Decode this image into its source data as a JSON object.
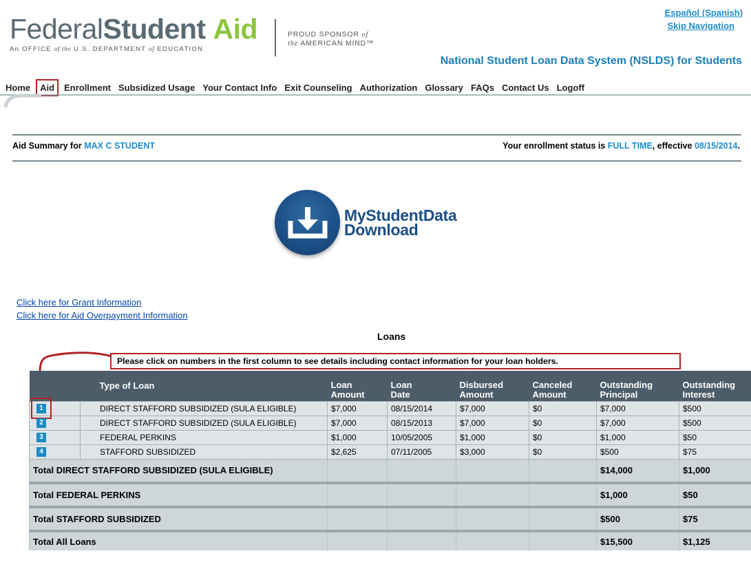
{
  "header": {
    "logo_federal": "Federal",
    "logo_student": "Student",
    "logo_aid": "Aid",
    "logo_sub_prefix": "An OFFICE",
    "logo_sub_of": "of the",
    "logo_sub_suffix": "U.S. DEPARTMENT",
    "logo_sub_of2": "of",
    "logo_sub_end": "EDUCATION",
    "sponsor_line1": "PROUD SPONSOR",
    "sponsor_of": "of",
    "sponsor_line2_italic": "the",
    "sponsor_line2": "AMERICAN MIND™",
    "lang_link": "Español (Spanish)",
    "skip_link": "Skip Navigation",
    "system_title": "National Student Loan Data System (NSLDS) for Students"
  },
  "nav": {
    "items": [
      "Home",
      "Aid",
      "Enrollment",
      "Subsidized Usage",
      "Your Contact Info",
      "Exit Counseling",
      "Authorization",
      "Glossary",
      "FAQs",
      "Contact Us",
      "Logoff"
    ],
    "active": "Aid"
  },
  "summary": {
    "prefix": "Aid Summary for",
    "student_name": "MAX C STUDENT",
    "status_prefix": "Your enrollment status is",
    "status": "FULL TIME",
    "effective_label": ", effective",
    "effective_date": "08/15/2014",
    "end": "."
  },
  "download": {
    "line1": "MyStudentData",
    "line2": "Download",
    "icon": "download-icon"
  },
  "links": {
    "grant": "Click here for Grant Information",
    "overpayment": "Click here for Aid Overpayment Information"
  },
  "loans": {
    "title": "Loans",
    "instruction": "Please click on numbers in the first column to see details including contact information for your loan holders.",
    "headers": {
      "type": "Type of Loan",
      "loan_amount": [
        "Loan",
        "Amount"
      ],
      "loan_date": [
        "Loan",
        "Date"
      ],
      "disbursed": [
        "Disbursed",
        "Amount"
      ],
      "canceled": [
        "Canceled",
        "Amount"
      ],
      "principal": [
        "Outstanding",
        "Principal"
      ],
      "interest": [
        "Outstanding",
        "Interest"
      ]
    },
    "rows": [
      {
        "num": "1",
        "type": "DIRECT STAFFORD SUBSIDIZED (SULA ELIGIBLE)",
        "amount": "$7,000",
        "date": "08/15/2014",
        "disbursed": "$7,000",
        "canceled": "$0",
        "principal": "$7,000",
        "interest": "$500"
      },
      {
        "num": "2",
        "type": "DIRECT STAFFORD SUBSIDIZED (SULA ELIGIBLE)",
        "amount": "$7,000",
        "date": "08/15/2013",
        "disbursed": "$7,000",
        "canceled": "$0",
        "principal": "$7,000",
        "interest": "$500"
      },
      {
        "num": "3",
        "type": "FEDERAL PERKINS",
        "amount": "$1,000",
        "date": "10/05/2005",
        "disbursed": "$1,000",
        "canceled": "$0",
        "principal": "$1,000",
        "interest": "$50"
      },
      {
        "num": "4",
        "type": "STAFFORD SUBSIDIZED",
        "amount": "$2,625",
        "date": "07/11/2005",
        "disbursed": "$3,000",
        "canceled": "$0",
        "principal": "$500",
        "interest": "$75"
      }
    ],
    "totals": [
      {
        "label": "Total DIRECT STAFFORD SUBSIDIZED (SULA ELIGIBLE)",
        "principal": "$14,000",
        "interest": "$1,000"
      },
      {
        "label": "Total FEDERAL PERKINS",
        "principal": "$1,000",
        "interest": "$50"
      },
      {
        "label": "Total STAFFORD SUBSIDIZED",
        "principal": "$500",
        "interest": "$75"
      },
      {
        "label": "Total All Loans",
        "principal": "$15,500",
        "interest": "$1,125"
      }
    ]
  },
  "colors": {
    "accent_blue": "#1d8dcf",
    "title_blue": "#1c7fb8",
    "logo_green": "#8cc63e",
    "table_header": "#4c5d69",
    "highlight_red": "#b22222"
  }
}
